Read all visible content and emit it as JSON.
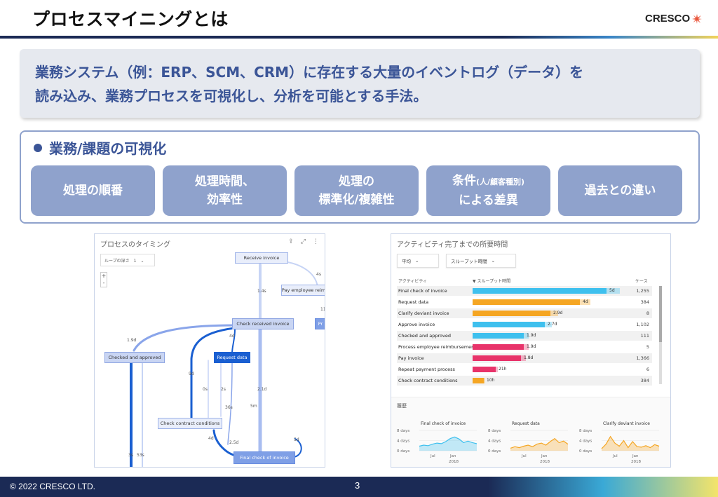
{
  "slide": {
    "title": "プロセスマイニングとは",
    "logo_text": "CRESCO",
    "definition_lines": [
      "業務システム（例：ERP、SCM、CRM）に存在する大量のイベントログ（データ）を",
      "読み込み、業務プロセスを可視化し、分析を可能とする手法。"
    ],
    "viz_heading": "業務/課題の可視化",
    "pills": [
      {
        "line1": "処理の順番",
        "line2": "",
        "small": ""
      },
      {
        "line1": "処理時間、",
        "line2": "効率性",
        "small": ""
      },
      {
        "line1": "処理の",
        "line2": "標準化/複雑性",
        "small": ""
      },
      {
        "line1": "条件",
        "line2": "による差異",
        "small": "(人/顧客種別)"
      },
      {
        "line1": "過去との違い",
        "line2": "",
        "small": ""
      }
    ],
    "footer": {
      "copyright": "© 2022 CRESCO LTD.",
      "page": "3"
    },
    "colors": {
      "navy": "#1b2a55",
      "accent": "#3b5597",
      "pill": "#8fa2cc",
      "node_dark": "#1a5fd1"
    }
  },
  "process_map": {
    "title": "プロセスのタイミング",
    "loop_label": "ループの深さ　1　⌄",
    "zoom_in": "+",
    "zoom_out": "-",
    "icons": [
      "share-icon",
      "expand-icon",
      "more-icon"
    ],
    "nodes": [
      {
        "label": "Receive invoice",
        "style": "light"
      },
      {
        "label": "Pay employee reim",
        "style": "light"
      },
      {
        "label": "Check received invoice",
        "style": "mid"
      },
      {
        "label": "Pr",
        "style": "lightblue"
      },
      {
        "label": "Checked and approved",
        "style": "mid"
      },
      {
        "label": "Request data",
        "style": "dark"
      },
      {
        "label": "Check contract conditions",
        "style": "light"
      },
      {
        "label": "Final check of invoice",
        "style": "lightblue"
      }
    ],
    "edge_labels": [
      "4s",
      "1.4s",
      "11",
      "1.9d",
      "4d",
      "9d",
      "0s",
      "2s",
      "2.1d",
      "36s",
      "5m",
      "2.5d",
      "5d",
      "4d",
      "3s",
      "53s"
    ]
  },
  "activity_chart": {
    "title": "アクティビティ完了までの所要時間",
    "filter_1": "平均",
    "filter_2": "スループット時間",
    "col_activity": "アクティビティ",
    "col_time": "▼ スループット時間",
    "col_cases": "ケース",
    "trend_header": "履歴",
    "colors": {
      "cyan": "#3ec0ee",
      "orange": "#f5a623",
      "pink": "#e8336a"
    }
  },
  "chart_data": {
    "type": "bar",
    "categories": [
      "Final check of invoice",
      "Request data",
      "Clarify deviant invoice",
      "Approve invoice",
      "Checked and approved",
      "Process employee reimbursement",
      "Pay invoice",
      "Repeat payment process",
      "Check contract conditions"
    ],
    "series": [
      {
        "values": [
          5,
          4,
          2.9,
          2.7,
          1.9,
          1.9,
          1.8,
          0.875,
          0.417
        ]
      }
    ],
    "value_labels": [
      "5d",
      "4d",
      "2.9d",
      "2.7d",
      "1.9d",
      "1.9d",
      "1.8d",
      "21h",
      "10h"
    ],
    "bar_colors": [
      "cyan",
      "orange",
      "orange",
      "cyan",
      "cyan",
      "pink",
      "pink",
      "pink",
      "orange"
    ],
    "cases": [
      "1,255",
      "384",
      "8",
      "1,102",
      "111",
      "5",
      "1,366",
      "6",
      "384"
    ],
    "xlim": [
      0,
      5.5
    ],
    "trends": [
      {
        "title": "Final check of invoice",
        "color": "cyan",
        "yticks": [
          "8 days",
          "4 days",
          "0 days"
        ],
        "xticks": [
          "Jul",
          "Jan"
        ],
        "year": "2018",
        "values": [
          1.8,
          2.2,
          2.0,
          2.6,
          3.0,
          2.8,
          3.6,
          4.8,
          5.4,
          4.6,
          3.2,
          3.8,
          3.2,
          2.8
        ]
      },
      {
        "title": "Request data",
        "color": "orange",
        "yticks": [
          "8 days",
          "4 days",
          "0 days"
        ],
        "xticks": [
          "Jul",
          "Jan"
        ],
        "year": "2018",
        "values": [
          1.0,
          1.6,
          1.2,
          1.8,
          2.2,
          1.6,
          2.6,
          3.0,
          2.2,
          3.6,
          4.8,
          3.2,
          3.8,
          2.6
        ]
      },
      {
        "title": "Clarify deviant invoice",
        "color": "orange",
        "yticks": [
          "8 days",
          "4 days",
          "0 days"
        ],
        "xticks": [
          "Jul",
          "Jan"
        ],
        "year": "2018",
        "values": [
          0.8,
          2.6,
          5.6,
          3.0,
          1.8,
          4.0,
          1.2,
          3.6,
          1.6,
          1.4,
          2.0,
          1.2,
          2.4,
          1.8
        ]
      }
    ]
  }
}
